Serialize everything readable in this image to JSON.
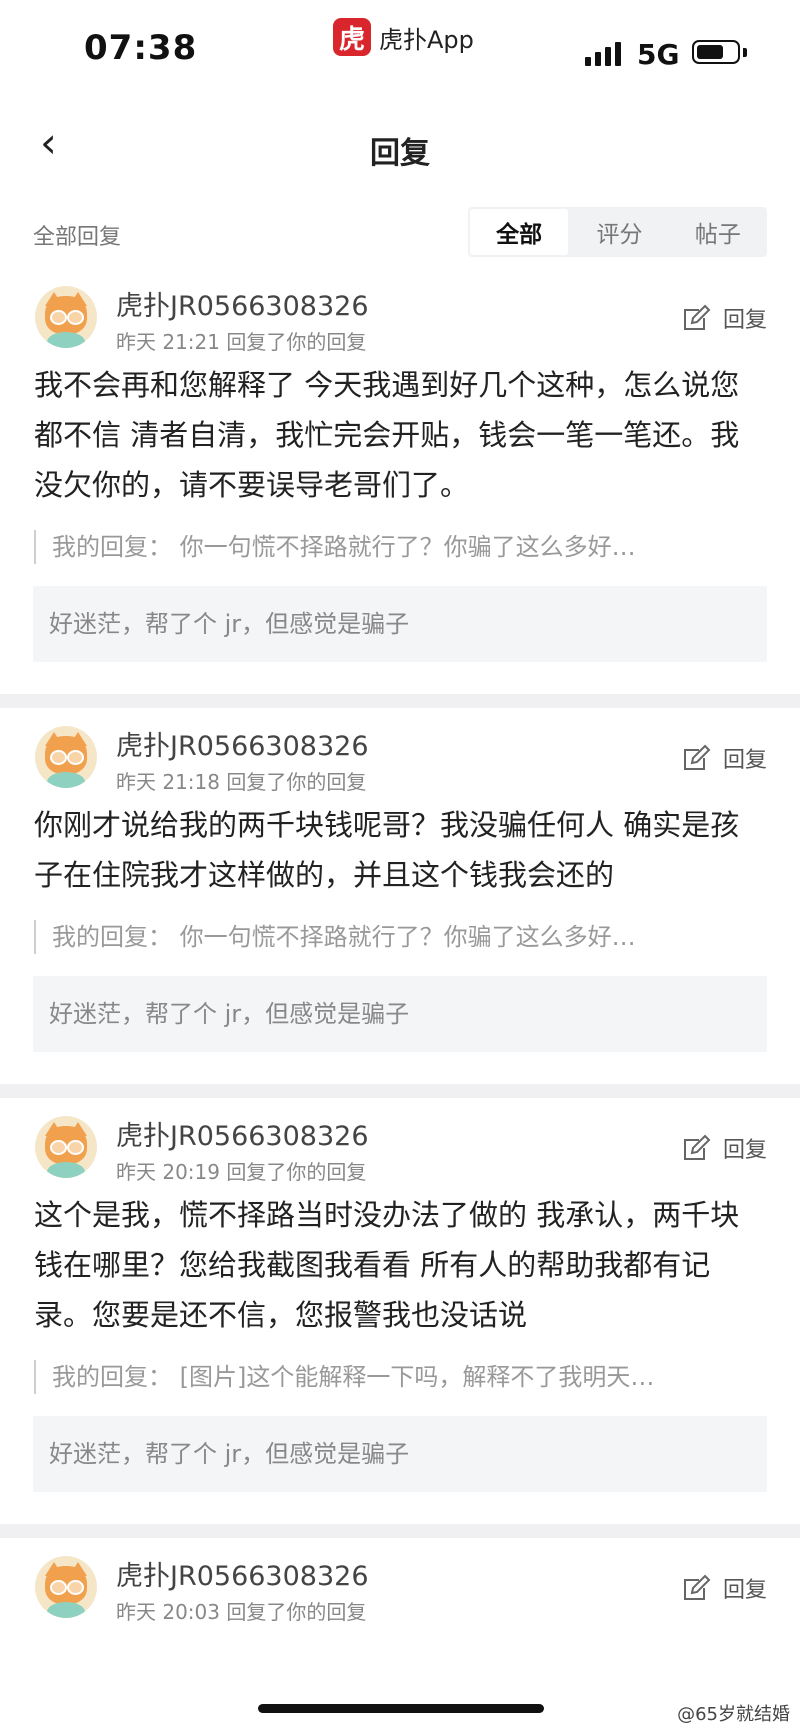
{
  "status_bar": {
    "time": "07:38",
    "app_logo": "虎",
    "app_name": "虎扑App",
    "network": "5G"
  },
  "header": {
    "back_icon": "‹",
    "title": "回复"
  },
  "filter": {
    "label": "全部回复",
    "tabs": [
      {
        "label": "全部",
        "active": true
      },
      {
        "label": "评分",
        "active": false
      },
      {
        "label": "帖子",
        "active": false
      }
    ]
  },
  "replies": [
    {
      "username": "虎扑JR0566308326",
      "meta": "昨天 21:21 回复了你的回复",
      "reply_label": "回复",
      "content": "我不会再和您解释了 今天我遇到好几个这种，怎么说您都不信 清者自清，我忙完会开贴，钱会一笔一笔还。我没欠你的，请不要误导老哥们了。",
      "my_reply": "我的回复：  你一句慌不择路就行了？你骗了这么多好…",
      "quote": "好迷茫，帮了个 jr，但感觉是骗子"
    },
    {
      "username": "虎扑JR0566308326",
      "meta": "昨天 21:18 回复了你的回复",
      "reply_label": "回复",
      "content": "你刚才说给我的两千块钱呢哥？我没骗任何人 确实是孩子在住院我才这样做的，并且这个钱我会还的",
      "my_reply": "我的回复：  你一句慌不择路就行了？你骗了这么多好…",
      "quote": "好迷茫，帮了个 jr，但感觉是骗子"
    },
    {
      "username": "虎扑JR0566308326",
      "meta": "昨天 20:19 回复了你的回复",
      "reply_label": "回复",
      "content": "这个是我，慌不择路当时没办法了做的 我承认，两千块钱在哪里？您给我截图我看看 所有人的帮助我都有记录。您要是还不信，您报警我也没话说",
      "my_reply": "我的回复：  [图片]这个能解释一下吗，解释不了我明天…",
      "quote": "好迷茫，帮了个 jr，但感觉是骗子"
    },
    {
      "username": "虎扑JR0566308326",
      "meta": "昨天 20:03 回复了你的回复",
      "reply_label": "回复"
    }
  ],
  "watermark": "@65岁就结婚"
}
